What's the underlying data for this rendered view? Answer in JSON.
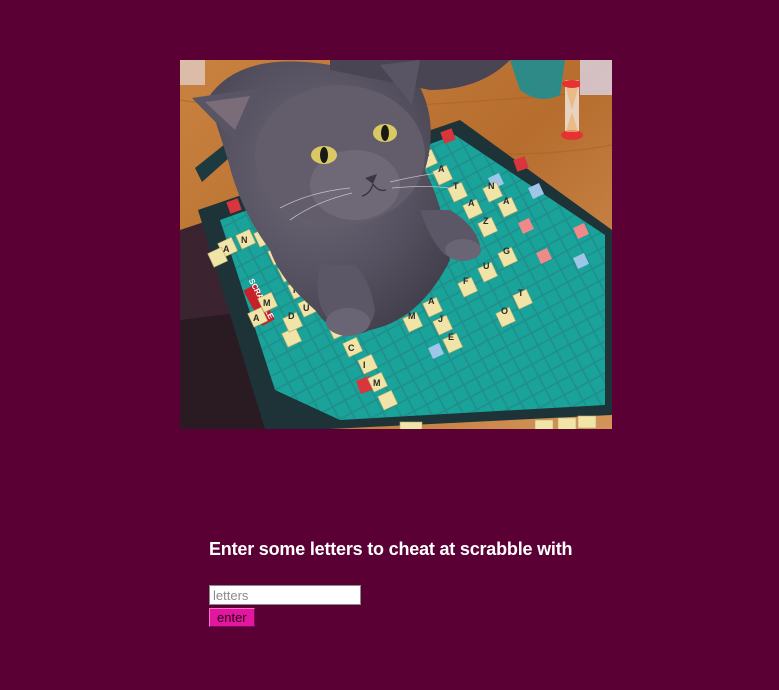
{
  "hero": {
    "alt": "grey cat sitting on a scrabble board"
  },
  "board": {
    "brand": "SCRABBLE"
  },
  "form": {
    "heading": "Enter some letters to cheat at scrabble with",
    "input_placeholder": "letters",
    "input_value": "",
    "submit_label": "enter"
  },
  "colors": {
    "background": "#5a0035",
    "button": "#e3169f",
    "heading_text": "#ffffff"
  }
}
